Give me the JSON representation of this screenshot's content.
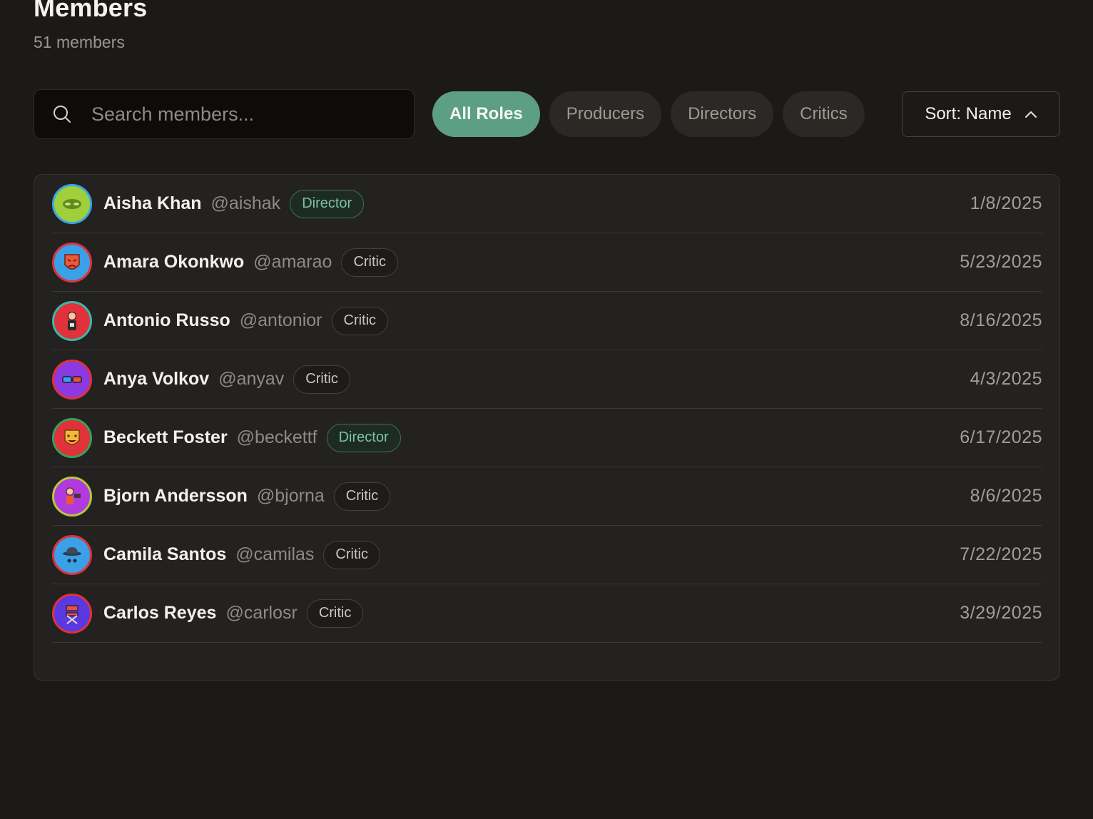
{
  "header": {
    "title": "Members",
    "count_label": "51 members"
  },
  "search": {
    "placeholder": "Search members...",
    "value": ""
  },
  "filters": [
    {
      "label": "All Roles",
      "active": true
    },
    {
      "label": "Producers",
      "active": false
    },
    {
      "label": "Directors",
      "active": false
    },
    {
      "label": "Critics",
      "active": false
    }
  ],
  "sort": {
    "label": "Sort: Name",
    "icon": "chevron-up-icon"
  },
  "colors": {
    "accent": "#5c9e86",
    "background": "#1b1a18",
    "panel": "#232220"
  },
  "members": [
    {
      "name": "Aisha Khan",
      "handle": "@aishak",
      "role": "Director",
      "date": "1/8/2025",
      "avatar": {
        "icon": "mask-icon",
        "bg": "#9fcf3a",
        "ring": "#3aa7e0"
      }
    },
    {
      "name": "Amara Okonkwo",
      "handle": "@amarao",
      "role": "Critic",
      "date": "5/23/2025",
      "avatar": {
        "icon": "theater-mask-icon",
        "bg": "#3aa0e8",
        "ring": "#e0323a"
      }
    },
    {
      "name": "Antonio Russo",
      "handle": "@antonior",
      "role": "Critic",
      "date": "8/16/2025",
      "avatar": {
        "icon": "person-icon",
        "bg": "#e0323a",
        "ring": "#3ab8a8"
      }
    },
    {
      "name": "Anya Volkov",
      "handle": "@anyav",
      "role": "Critic",
      "date": "4/3/2025",
      "avatar": {
        "icon": "3d-glasses-icon",
        "bg": "#8a3ae0",
        "ring": "#e0323a"
      }
    },
    {
      "name": "Beckett Foster",
      "handle": "@beckettf",
      "role": "Director",
      "date": "6/17/2025",
      "avatar": {
        "icon": "smiling-mask-icon",
        "bg": "#e0323a",
        "ring": "#3aa05a"
      }
    },
    {
      "name": "Bjorn Andersson",
      "handle": "@bjorna",
      "role": "Critic",
      "date": "8/6/2025",
      "avatar": {
        "icon": "camera-operator-icon",
        "bg": "#b03ae0",
        "ring": "#b8c83a"
      }
    },
    {
      "name": "Camila Santos",
      "handle": "@camilas",
      "role": "Critic",
      "date": "7/22/2025",
      "avatar": {
        "icon": "hat-icon",
        "bg": "#3aa0e8",
        "ring": "#e0323a"
      }
    },
    {
      "name": "Carlos Reyes",
      "handle": "@carlosr",
      "role": "Critic",
      "date": "3/29/2025",
      "avatar": {
        "icon": "director-chair-icon",
        "bg": "#5a3ae0",
        "ring": "#e0323a"
      }
    }
  ]
}
